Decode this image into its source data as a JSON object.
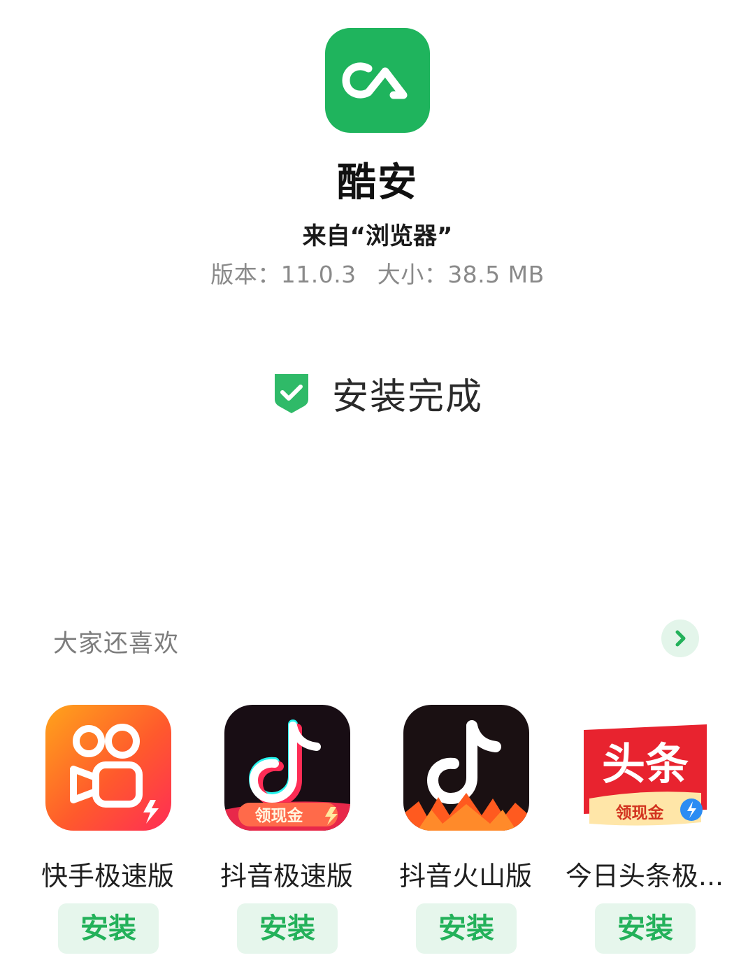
{
  "app": {
    "name": "酷安",
    "source": "来自“浏览器”",
    "version_label": "版本：11.0.3",
    "size_label": "大小：38.5 MB",
    "icon": "coolapk-logo-icon",
    "brand_color": "#1fb45d"
  },
  "status": {
    "text": "安装完成",
    "icon": "shield-check-icon",
    "color": "#2fba68"
  },
  "recommend": {
    "title": "大家还喜欢",
    "more_icon": "chevron-right-icon",
    "items": [
      {
        "name": "快手极速版",
        "icon": "kuaishou-lite-icon",
        "button": "安装"
      },
      {
        "name": "抖音极速版",
        "icon": "douyin-lite-icon",
        "badge": "领现金",
        "button": "安装"
      },
      {
        "name": "抖音火山版",
        "icon": "douyin-huoshan-icon",
        "button": "安装"
      },
      {
        "name": "今日头条极...",
        "icon": "toutiao-lite-icon",
        "icon_text": "头条",
        "badge": "领现金",
        "button": "安装"
      }
    ]
  }
}
